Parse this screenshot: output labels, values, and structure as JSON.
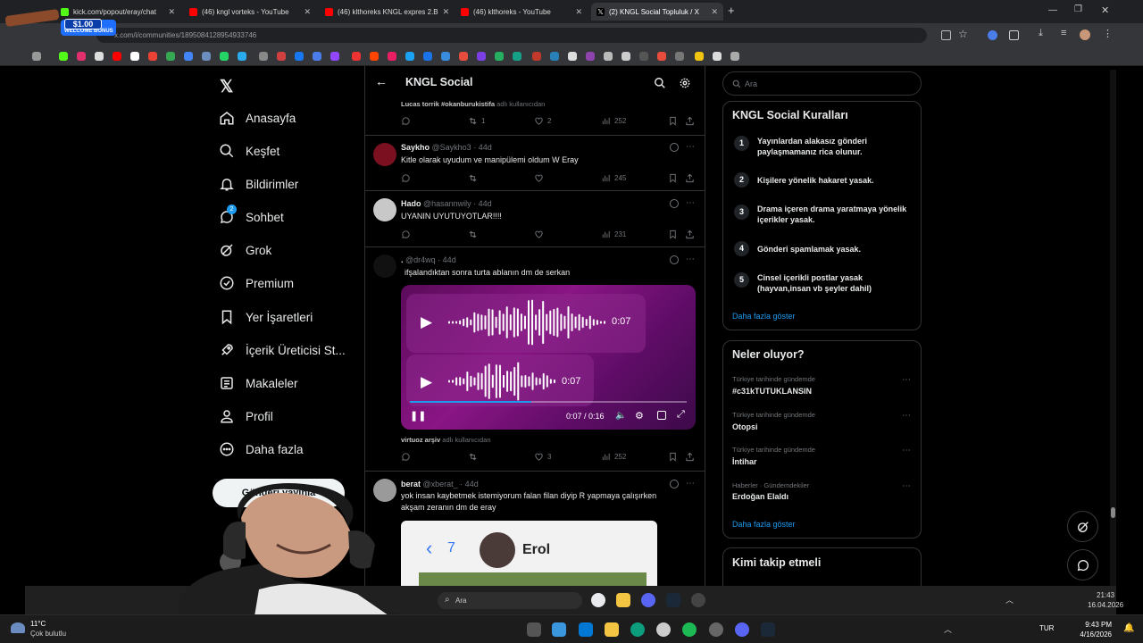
{
  "browser": {
    "tabs": [
      {
        "label": "kick.com/popout/eray/chat",
        "color": "#53fc18"
      },
      {
        "label": "(46) kngl vorteks - YouTube",
        "color": "#ff0000"
      },
      {
        "label": "(46) klthoreks KNGL expres 2.B",
        "color": "#ff0000"
      },
      {
        "label": "(46) klthoreks - YouTube",
        "color": "#ff0000"
      },
      {
        "label": "(2) KNGL Social Topluluk / X",
        "color": "#ffffff"
      }
    ],
    "url": "x.com/i/communities/1895084128954933746",
    "close_glyph": "✕",
    "new_tab_glyph": "+"
  },
  "overlay_badge": {
    "amount": "$1.00",
    "text": "WELCOME BONUS"
  },
  "sidebar": {
    "logo": "x-logo-icon",
    "items": [
      {
        "label": "Anasayfa",
        "icon": "home-icon"
      },
      {
        "label": "Keşfet",
        "icon": "search-icon"
      },
      {
        "label": "Bildirimler",
        "icon": "bell-icon"
      },
      {
        "label": "Sohbet",
        "icon": "chat-icon",
        "badge": "2"
      },
      {
        "label": "Grok",
        "icon": "grok-icon"
      },
      {
        "label": "Premium",
        "icon": "premium-icon"
      },
      {
        "label": "Yer İşaretleri",
        "icon": "bookmark-icon"
      },
      {
        "label": "İçerik Üreticisi St...",
        "icon": "rocket-icon"
      },
      {
        "label": "Makaleler",
        "icon": "article-icon"
      },
      {
        "label": "Profil",
        "icon": "profile-icon"
      },
      {
        "label": "Daha fazla",
        "icon": "more-icon"
      }
    ],
    "post_button": "Gönderi yayınla"
  },
  "header": {
    "title": "KNGL Social"
  },
  "feed": {
    "top_context": {
      "name": "Lucas torrik #okanburukistifa",
      "suffix": "adlı kullanıcıdan"
    },
    "top_actions": {
      "replies": "",
      "reposts": "1",
      "likes": "2",
      "views": "252"
    },
    "tweets": [
      {
        "name": "Saykho",
        "handle": "@Saykho3 · 44d",
        "text": "Kitle olarak uyudum ve manipülemi oldum W Eray",
        "views": "245",
        "avatar_color": "#7a1020"
      },
      {
        "name": "Hado",
        "handle": "@hasannwily · 44d",
        "text": "UYANIN UYUTUYOTLAR!!!!",
        "views": "231",
        "avatar_color": "#c8c8c8"
      },
      {
        "name": ".",
        "handle": "@dr4wq · 44d",
        "text": "ifşalandıktan sonra turta ablanın dm de serkan",
        "views": "252",
        "likes": "3",
        "avatar_color": "#111111"
      },
      {
        "name": "berat",
        "handle": "@xberat_ · 44d",
        "text": "yok insan kaybetmek istemiyorum falan filan diyip R yapmaya çalışırken",
        "text2": "akşam zeranın dm de eray",
        "avatar_color": "#9a9a9a"
      }
    ],
    "video": {
      "audio1_time": "0:07",
      "audio2_time": "0:07",
      "player_time": "0:07 / 0:16",
      "progress": 0.44
    },
    "video_context": {
      "name": "virtuoz arşiv",
      "suffix": "adlı kullanıcıdan"
    },
    "image_preview": {
      "back_count": "7",
      "contact_name": "Erol"
    }
  },
  "right": {
    "search_placeholder": "Ara",
    "rules_title": "KNGL Social Kuralları",
    "rules": [
      {
        "num": "1",
        "text": "Yayınlardan alakasız gönderi paylaşmamanız rica olunur."
      },
      {
        "num": "2",
        "text": "Kişilere yönelik hakaret yasak."
      },
      {
        "num": "3",
        "text": "Drama içeren drama yaratmaya yönelik içerikler yasak."
      },
      {
        "num": "4",
        "text": "Gönderi spamlamak yasak."
      },
      {
        "num": "5",
        "text": "Cinsel içerikli postlar yasak (hayvan,insan vb şeyler dahil)"
      }
    ],
    "rules_more": "Daha fazla göster",
    "trends_title": "Neler oluyor?",
    "trends": [
      {
        "sub": "Türkiye tarihinde gündemde",
        "name": "#c31kTUTUKLANSIN"
      },
      {
        "sub": "Türkiye tarihinde gündemde",
        "name": "Otopsi"
      },
      {
        "sub": "Türkiye tarihinde gündemde",
        "name": "İntihar"
      },
      {
        "sub": "Haberler · Gündemdekiler",
        "name": "Erdoğan Elaldı"
      }
    ],
    "trends_more": "Daha fazla göster",
    "follow_title": "Kimi takip etmeli"
  },
  "inner_taskbar": {
    "search": "Ara",
    "time": "21:43",
    "date": "16.04.2026"
  },
  "taskbar": {
    "weather_temp": "11°C",
    "weather_desc": "Çok bulutlu",
    "lang": "TUR",
    "time": "9:43 PM",
    "date": "4/16/2026"
  }
}
